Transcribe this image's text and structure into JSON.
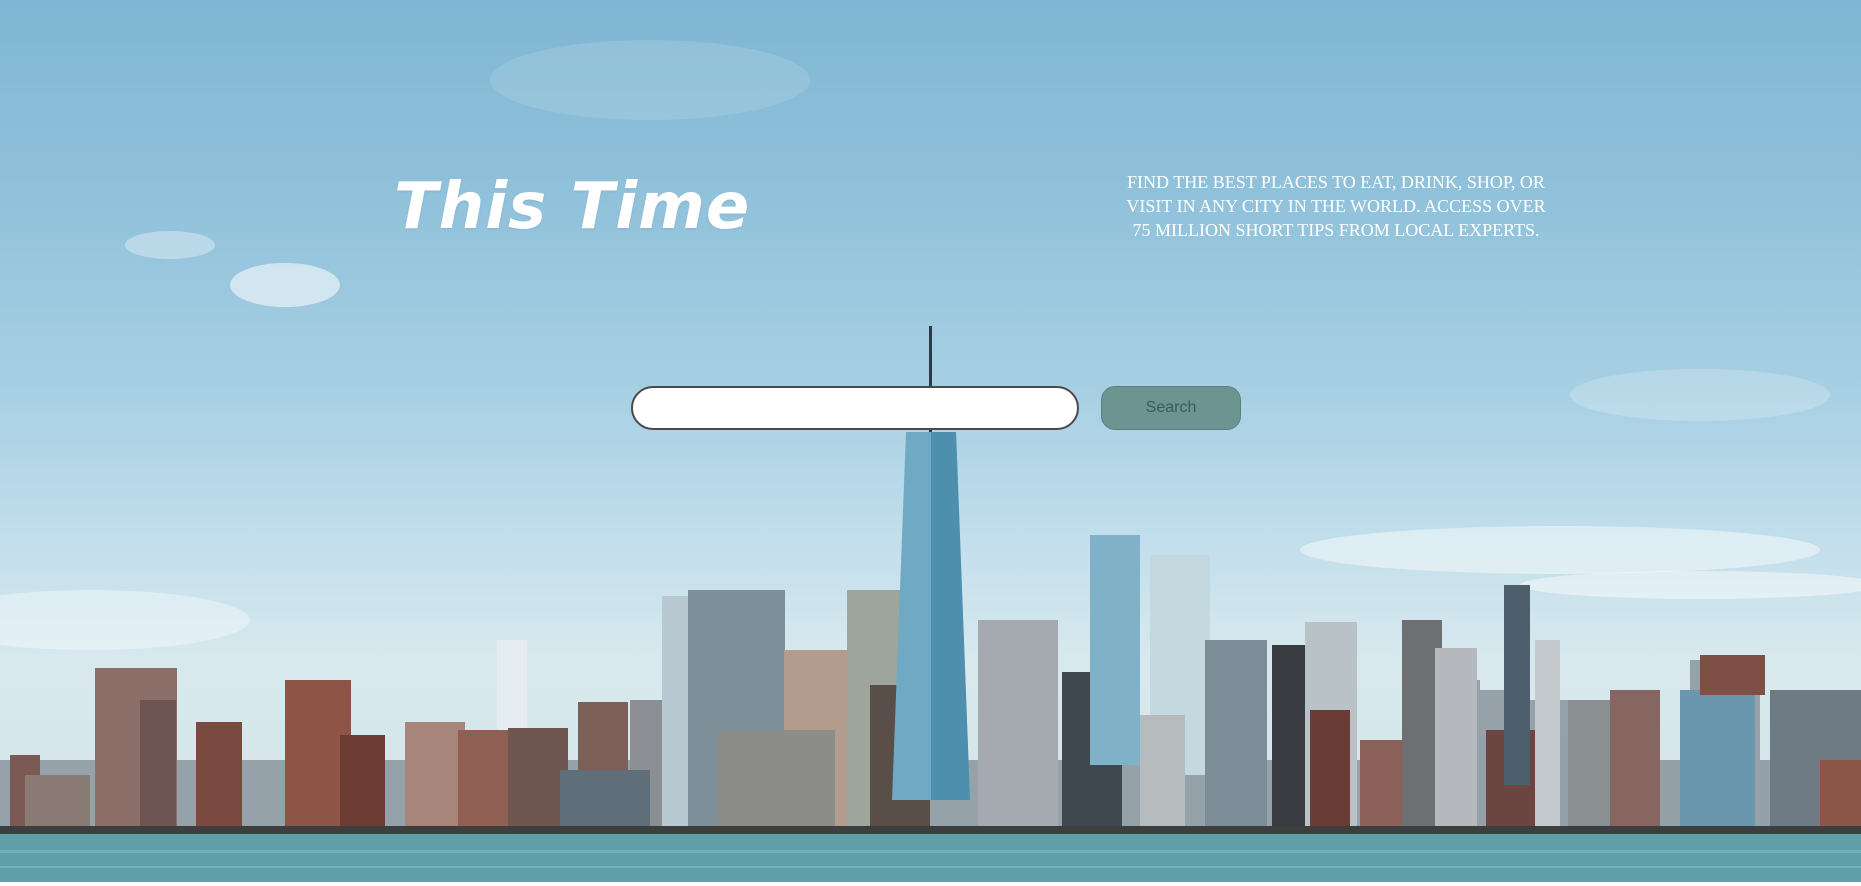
{
  "brand": {
    "title": "This Time"
  },
  "tagline": {
    "text": "Find the best places to eat, drink, shop, or visit in any city in the world. Access over 75 million short tips from local experts."
  },
  "search": {
    "value": "",
    "placeholder": "",
    "button_label": "Search"
  },
  "colors": {
    "search_button_bg": "#6c9490",
    "search_button_text": "#3e5a5a",
    "sky_top": "#7fb6d3",
    "water": "#5fa0a8"
  }
}
